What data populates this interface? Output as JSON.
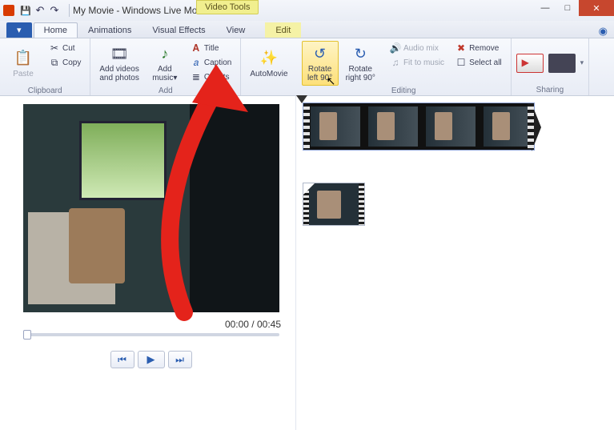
{
  "titlebar": {
    "document_title": "My Movie",
    "app_title": "Windows Live Movie ...",
    "context_tab": "Video Tools"
  },
  "tabs": {
    "file": "",
    "home": "Home",
    "animations": "Animations",
    "visual_effects": "Visual Effects",
    "view": "View",
    "edit": "Edit"
  },
  "ribbon": {
    "clipboard": {
      "label": "Clipboard",
      "paste": "Paste",
      "cut": "Cut",
      "copy": "Copy"
    },
    "add": {
      "label": "Add",
      "add_media": "Add videos\nand photos",
      "add_music": "Add\nmusic",
      "title": "Title",
      "caption": "Caption",
      "credits": "Credits"
    },
    "automovie": "AutoMovie",
    "editing": {
      "label": "Editing",
      "rotate_left": "Rotate\nleft 90°",
      "rotate_right": "Rotate\nright 90°",
      "audio_mix": "Audio mix",
      "fit_to_music": "Fit to music",
      "remove": "Remove",
      "select_all": "Select all"
    },
    "sharing": {
      "label": "Sharing"
    }
  },
  "preview": {
    "time_readout": "00:00 / 00:45"
  }
}
